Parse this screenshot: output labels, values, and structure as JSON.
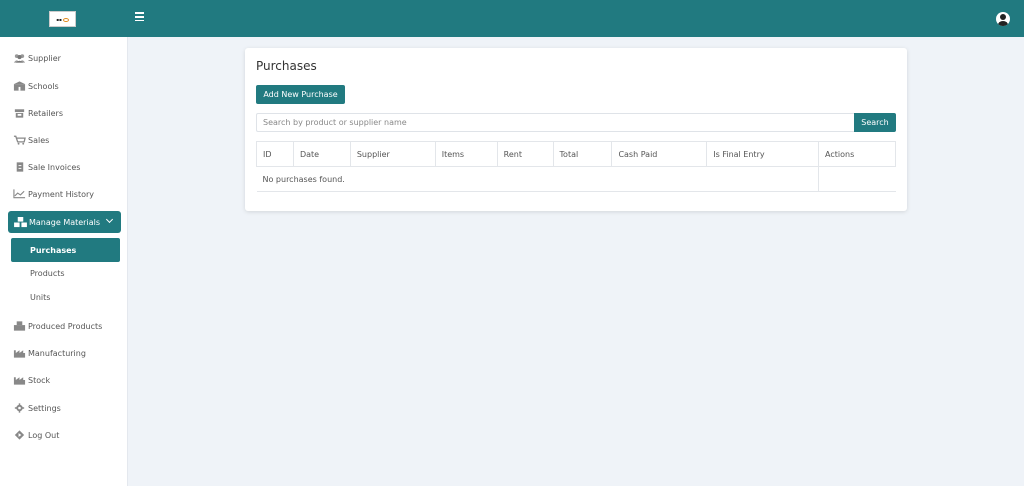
{
  "colors": {
    "primary": "#217a80",
    "background": "#eff3f8"
  },
  "header": {
    "menu_icon": "hamburger-icon",
    "user_icon": "user-avatar-icon"
  },
  "sidebar": {
    "items": [
      {
        "label": "Supplier",
        "icon": "users-icon"
      },
      {
        "label": "Schools",
        "icon": "school-icon"
      },
      {
        "label": "Retailers",
        "icon": "store-icon"
      },
      {
        "label": "Sales",
        "icon": "cart-icon"
      },
      {
        "label": "Sale Invoices",
        "icon": "invoice-icon"
      },
      {
        "label": "Payment History",
        "icon": "line-chart-icon"
      }
    ],
    "manage": {
      "label": "Manage Materials",
      "icon": "cubes-icon"
    },
    "sub": [
      {
        "label": "Purchases"
      },
      {
        "label": "Products"
      },
      {
        "label": "Units"
      }
    ],
    "items2": [
      {
        "label": "Produced Products",
        "icon": "boxes-icon"
      },
      {
        "label": "Manufacturing",
        "icon": "factory-icon"
      },
      {
        "label": "Stock",
        "icon": "warehouse-icon"
      },
      {
        "label": "Settings",
        "icon": "gear-icon"
      },
      {
        "label": "Log Out",
        "icon": "logout-icon"
      }
    ]
  },
  "main": {
    "title": "Purchases",
    "add_button": "Add New Purchase",
    "search": {
      "placeholder": "Search by product or supplier name",
      "value": "",
      "button": "Search"
    },
    "table": {
      "columns": [
        "ID",
        "Date",
        "Supplier",
        "Items",
        "Rent",
        "Total",
        "Cash Paid",
        "Is Final Entry",
        "Actions"
      ],
      "empty_message": "No purchases found."
    }
  }
}
